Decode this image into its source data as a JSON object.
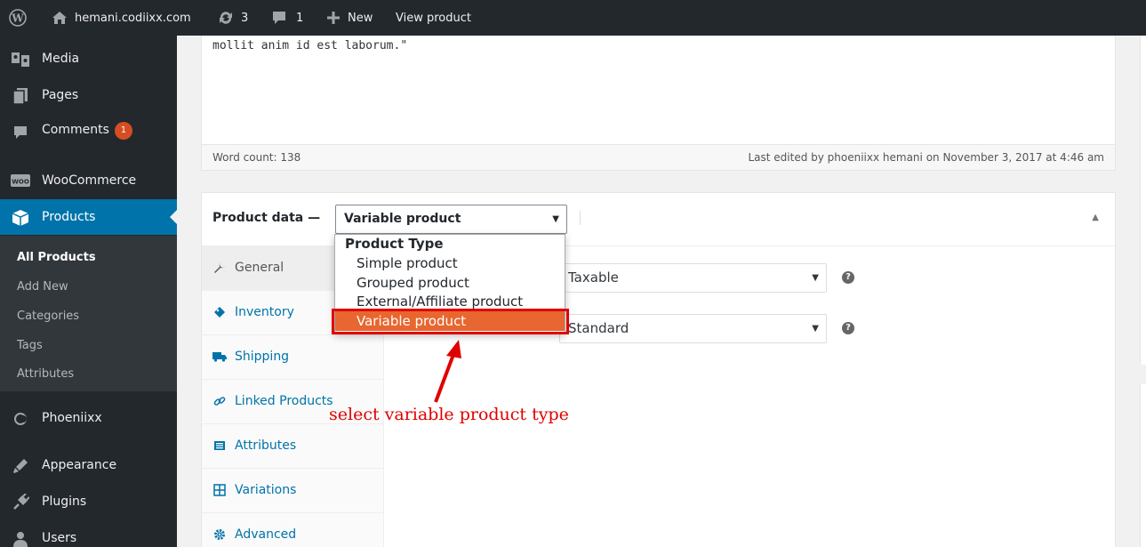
{
  "adminbar": {
    "site_name": "hemani.codiixx.com",
    "updates_count": "3",
    "comments_count": "1",
    "new_label": "New",
    "view_product_label": "View product",
    "bg_color": "#23282d"
  },
  "sidebar": {
    "items": [
      {
        "label": "Media",
        "icon": "media-icon"
      },
      {
        "label": "Pages",
        "icon": "pages-icon"
      },
      {
        "label": "Comments",
        "icon": "comments-icon",
        "badge": "1"
      },
      {
        "label": "WooCommerce",
        "icon": "woocommerce-icon"
      },
      {
        "label": "Products",
        "icon": "products-icon",
        "current": true
      },
      {
        "label": "Phoeniixx",
        "icon": "phoeniixx-icon"
      },
      {
        "label": "Appearance",
        "icon": "appearance-icon"
      },
      {
        "label": "Plugins",
        "icon": "plugins-icon"
      },
      {
        "label": "Users",
        "icon": "users-icon"
      }
    ],
    "submenu": [
      "All Products",
      "Add New",
      "Categories",
      "Tags",
      "Attributes"
    ],
    "accent_color": "#0073aa"
  },
  "editor": {
    "text": "mollit anim id est laborum.\"",
    "word_count": "Word count: 138",
    "last_edited": "Last edited by phoeniixx hemani on November 3, 2017 at 4:46 am"
  },
  "product_data": {
    "title": "Product data —",
    "selected_type": "Variable product",
    "dropdown": {
      "group_label": "Product Type",
      "options": [
        "Simple product",
        "Grouped product",
        "External/Affiliate product",
        "Variable product"
      ],
      "selected_index": 3,
      "highlight_color": "#e8662f"
    },
    "tabs": [
      {
        "label": "General",
        "icon": "wrench-icon"
      },
      {
        "label": "Inventory",
        "icon": "inventory-icon"
      },
      {
        "label": "Shipping",
        "icon": "truck-icon"
      },
      {
        "label": "Linked Products",
        "icon": "link-icon"
      },
      {
        "label": "Attributes",
        "icon": "list-icon"
      },
      {
        "label": "Variations",
        "icon": "grid-icon"
      },
      {
        "label": "Advanced",
        "icon": "gear-icon"
      }
    ],
    "tax_status": "Taxable",
    "tax_class": "Standard"
  },
  "annotation": {
    "text": "select variable product type",
    "color": "#e00000"
  }
}
